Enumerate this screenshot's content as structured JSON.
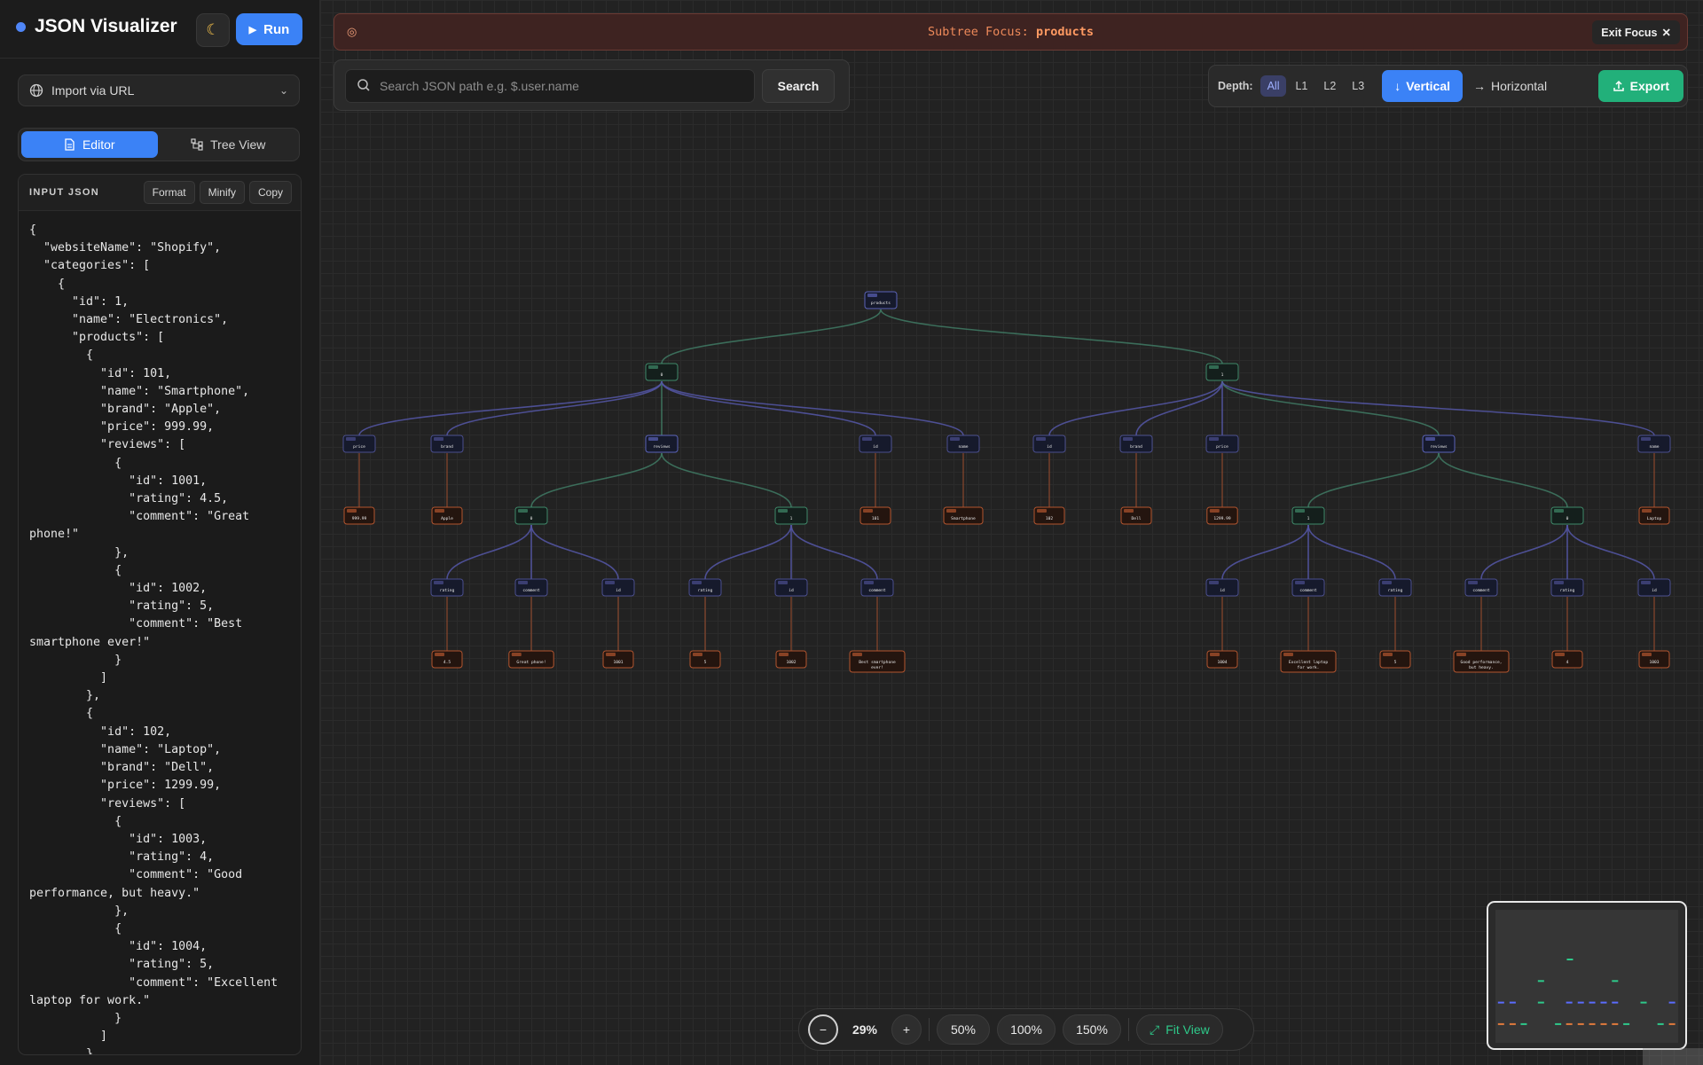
{
  "app": {
    "title": "JSON Visualizer",
    "run_label": "Run",
    "theme_icon": "moon-icon"
  },
  "import": {
    "label": "Import via URL"
  },
  "tabs": [
    {
      "label": "Editor",
      "active": true
    },
    {
      "label": "Tree View",
      "active": false
    }
  ],
  "editor": {
    "header": "INPUT JSON",
    "buttons": [
      "Format",
      "Minify",
      "Copy"
    ],
    "code": "{\n  \"websiteName\": \"Shopify\",\n  \"categories\": [\n    {\n      \"id\": 1,\n      \"name\": \"Electronics\",\n      \"products\": [\n        {\n          \"id\": 101,\n          \"name\": \"Smartphone\",\n          \"brand\": \"Apple\",\n          \"price\": 999.99,\n          \"reviews\": [\n            {\n              \"id\": 1001,\n              \"rating\": 4.5,\n              \"comment\": \"Great\nphone!\"\n            },\n            {\n              \"id\": 1002,\n              \"rating\": 5,\n              \"comment\": \"Best\nsmartphone ever!\"\n            }\n          ]\n        },\n        {\n          \"id\": 102,\n          \"name\": \"Laptop\",\n          \"brand\": \"Dell\",\n          \"price\": 1299.99,\n          \"reviews\": [\n            {\n              \"id\": 1003,\n              \"rating\": 4,\n              \"comment\": \"Good\nperformance, but heavy.\"\n            },\n            {\n              \"id\": 1004,\n              \"rating\": 5,\n              \"comment\": \"Excellent\nlaptop for work.\"\n            }\n          ]\n        }"
  },
  "focus": {
    "prefix": "Subtree Focus:",
    "path": "products",
    "exit_label": "Exit Focus"
  },
  "search": {
    "placeholder": "Search JSON path e.g. $.user.name",
    "button": "Search"
  },
  "depth": {
    "label": "Depth:",
    "options": [
      "All",
      "L1",
      "L2",
      "L3"
    ],
    "selected": "All"
  },
  "layout": {
    "vertical": "Vertical",
    "horizontal": "Horizontal",
    "export": "Export",
    "selected": "Vertical"
  },
  "zoom": {
    "minus": "−",
    "percent": "29%",
    "plus": "+",
    "presets": [
      "50%",
      "100%",
      "150%"
    ],
    "fit": "Fit View"
  },
  "colors": {
    "accent": "#3b82f6",
    "export": "#22b07a",
    "focus_text": "#ee8a5a",
    "edge_blue": "#5557a8",
    "edge_green": "#3f7a64",
    "edge_orange": "#b3552f"
  },
  "tree": {
    "nodes": [
      {
        "id": "root",
        "label": "products",
        "kind": "array",
        "parent": null
      },
      {
        "id": "p0",
        "label": "0",
        "kind": "object",
        "parent": "root"
      },
      {
        "id": "p1",
        "label": "1",
        "kind": "object",
        "parent": "root"
      },
      {
        "id": "p0_price",
        "label": "price",
        "kind": "key",
        "parent": "p0"
      },
      {
        "id": "p0_brand",
        "label": "brand",
        "kind": "key",
        "parent": "p0"
      },
      {
        "id": "p0_reviews",
        "label": "reviews",
        "kind": "array",
        "parent": "p0"
      },
      {
        "id": "p0_id",
        "label": "id",
        "kind": "key",
        "parent": "p0"
      },
      {
        "id": "p0_name",
        "label": "name",
        "kind": "key",
        "parent": "p0"
      },
      {
        "id": "p1_id",
        "label": "id",
        "kind": "key",
        "parent": "p1"
      },
      {
        "id": "p1_brand",
        "label": "brand",
        "kind": "key",
        "parent": "p1"
      },
      {
        "id": "p1_price",
        "label": "price",
        "kind": "key",
        "parent": "p1"
      },
      {
        "id": "p1_reviews",
        "label": "reviews",
        "kind": "array",
        "parent": "p1"
      },
      {
        "id": "p1_name",
        "label": "name",
        "kind": "key",
        "parent": "p1"
      },
      {
        "id": "v_p0_price",
        "label": "999.99",
        "kind": "value",
        "parent": "p0_price"
      },
      {
        "id": "v_p0_brand",
        "label": "Apple",
        "kind": "value",
        "parent": "p0_brand"
      },
      {
        "id": "r00",
        "label": "0",
        "kind": "object",
        "parent": "p0_reviews"
      },
      {
        "id": "r01",
        "label": "1",
        "kind": "object",
        "parent": "p0_reviews"
      },
      {
        "id": "v_p0_id",
        "label": "101",
        "kind": "value",
        "parent": "p0_id"
      },
      {
        "id": "v_p0_name",
        "label": "Smartphone",
        "kind": "value",
        "parent": "p0_name"
      },
      {
        "id": "v_p1_id",
        "label": "102",
        "kind": "value",
        "parent": "p1_id"
      },
      {
        "id": "v_p1_brand",
        "label": "Dell",
        "kind": "value",
        "parent": "p1_brand"
      },
      {
        "id": "v_p1_price",
        "label": "1299.99",
        "kind": "value",
        "parent": "p1_price"
      },
      {
        "id": "r11",
        "label": "1",
        "kind": "object",
        "parent": "p1_reviews"
      },
      {
        "id": "r10",
        "label": "0",
        "kind": "object",
        "parent": "p1_reviews"
      },
      {
        "id": "v_p1_name",
        "label": "Laptop",
        "kind": "value",
        "parent": "p1_name"
      },
      {
        "id": "r00_rating",
        "label": "rating",
        "kind": "key",
        "parent": "r00"
      },
      {
        "id": "r00_comment",
        "label": "comment",
        "kind": "key",
        "parent": "r00"
      },
      {
        "id": "r00_id",
        "label": "id",
        "kind": "key",
        "parent": "r00"
      },
      {
        "id": "r01_rating",
        "label": "rating",
        "kind": "key",
        "parent": "r01"
      },
      {
        "id": "r01_id",
        "label": "id",
        "kind": "key",
        "parent": "r01"
      },
      {
        "id": "r01_comment",
        "label": "comment",
        "kind": "key",
        "parent": "r01"
      },
      {
        "id": "r11_id",
        "label": "id",
        "kind": "key",
        "parent": "r11"
      },
      {
        "id": "r11_comment",
        "label": "comment",
        "kind": "key",
        "parent": "r11"
      },
      {
        "id": "r11_rating",
        "label": "rating",
        "kind": "key",
        "parent": "r11"
      },
      {
        "id": "r10_comment",
        "label": "comment",
        "kind": "key",
        "parent": "r10"
      },
      {
        "id": "r10_rating",
        "label": "rating",
        "kind": "key",
        "parent": "r10"
      },
      {
        "id": "r10_id",
        "label": "id",
        "kind": "key",
        "parent": "r10"
      },
      {
        "id": "v_r00_rating",
        "label": "4.5",
        "kind": "value",
        "parent": "r00_rating"
      },
      {
        "id": "v_r00_comment",
        "label": "Great phone!",
        "kind": "value",
        "parent": "r00_comment"
      },
      {
        "id": "v_r00_id",
        "label": "1001",
        "kind": "value",
        "parent": "r00_id"
      },
      {
        "id": "v_r01_rating",
        "label": "5",
        "kind": "value",
        "parent": "r01_rating"
      },
      {
        "id": "v_r01_id",
        "label": "1002",
        "kind": "value",
        "parent": "r01_id"
      },
      {
        "id": "v_r01_comment",
        "label": "Best smartphone ever!",
        "kind": "value",
        "parent": "r01_comment"
      },
      {
        "id": "v_r11_id",
        "label": "1004",
        "kind": "value",
        "parent": "r11_id"
      },
      {
        "id": "v_r11_comment",
        "label": "Excellent laptop for work.",
        "kind": "value",
        "parent": "r11_comment"
      },
      {
        "id": "v_r11_rating",
        "label": "5",
        "kind": "value",
        "parent": "r11_rating"
      },
      {
        "id": "v_r10_comment",
        "label": "Good performance, but heavy.",
        "kind": "value",
        "parent": "r10_comment"
      },
      {
        "id": "v_r10_rating",
        "label": "4",
        "kind": "value",
        "parent": "r10_rating"
      },
      {
        "id": "v_r10_id",
        "label": "1003",
        "kind": "value",
        "parent": "r10_id"
      }
    ]
  }
}
